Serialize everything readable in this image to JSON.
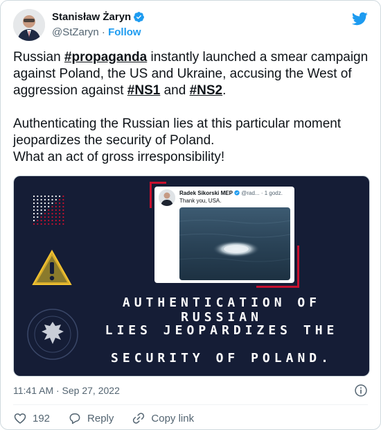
{
  "author": {
    "display_name": "Stanisław Żaryn",
    "handle": "@StZaryn",
    "separator": "·",
    "follow_label": "Follow"
  },
  "tweet": {
    "line1_pre": "Russian ",
    "hashtag_propaganda": "#propaganda",
    "line1_post": " instantly launched a smear campaign against Poland, the US and Ukraine, accusing the West of aggression against ",
    "hashtag_ns1": "#NS1",
    "and_text": " and ",
    "hashtag_ns2": "#NS2",
    "period": ".",
    "para2_line1": "Authenticating the Russian lies at this particular moment jeopardizes the security of Poland.",
    "para2_line2": "What an act of gross irresponsibility!"
  },
  "media": {
    "headline_1": "AUTHENTICATION OF RUSSIAN",
    "headline_2": "LIES JEOPARDIZES THE",
    "headline_3": "SECURITY OF POLAND.",
    "inner_tweet": {
      "name": "Radek Sikorski MEP",
      "meta": "@rad... · 1 godz.",
      "text": "Thank you, USA."
    }
  },
  "footer": {
    "timestamp": "11:41 AM · Sep 27, 2022",
    "likes": "192",
    "reply_label": "Reply",
    "copy_link_label": "Copy link"
  },
  "colors": {
    "accent": "#1d9bf0",
    "media_bg": "#151d36",
    "red": "#c8102e",
    "warning_yellow": "#f2c230"
  },
  "icons": [
    "verified-badge-icon",
    "twitter-bird-icon",
    "info-icon",
    "heart-icon",
    "reply-icon",
    "link-icon",
    "warning-icon",
    "eagle-seal-icon"
  ]
}
